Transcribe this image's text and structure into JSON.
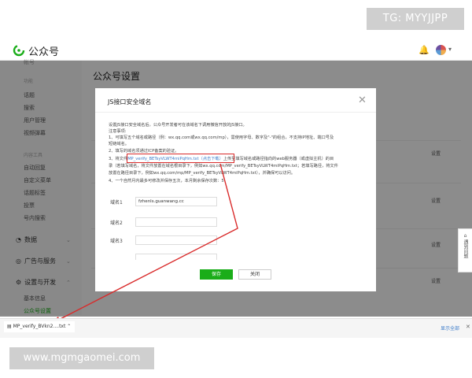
{
  "watermark_top": "TG: MYYJJPP",
  "watermark_bottom": "www.mgmgaomei.com",
  "header": {
    "app_title": "公众号",
    "bell_icon": "bell-icon",
    "avatar_icon": "avatar-icon"
  },
  "sidebar": {
    "top_partial": "帐号",
    "section_function": "功能",
    "items_function": [
      "话题",
      "搜索",
      "用户管理",
      "视频弹幕"
    ],
    "section_ext": "内容工具",
    "items_ext": [
      "自动回复",
      "自定义菜单",
      "话题标签",
      "投票",
      "号内搜索"
    ],
    "group_data": "数据",
    "group_ads": "广告与服务",
    "group_settings": "设置与开发",
    "items_settings": [
      "基本信息",
      "公众号设置"
    ]
  },
  "main": {
    "page_title": "公众号设置",
    "row_action": "设置"
  },
  "dialog": {
    "title": "JS接口安全域名",
    "lines": [
      "设置JS接口安全域名后，公众号开发者可在该域名下调用微信开放的JS接口。",
      "注意事项:",
      "1、可填写五个域名或路径（例：wx.qq.com或wx.qq.com/mp），需使用字母、数字及\"-\"的组合，不支持IP地址、端口号及",
      "短链域名。",
      "2、填写的域名须通过ICP备案的验证。"
    ],
    "line3_prefix": "3、将文件",
    "line3_link": "MP_verify_BETsyVLWT4miPqHm.txt（点击下载）",
    "line3_suffix": "上传至填写域名或路径指向的web服务器（或虚拟主机）的目",
    "line3_more": [
      "录（若填写域名，将文件放置在域名根目录下，例如wx.qq.com/MP_verify_BETsyVLWT4miPqHm.txt；若填写路径，将文件",
      "放置在路径目录下，例如wx.qq.com/mp/MP_verify_BETsyVLWT4miPqHm.txt），并确保可以访问。"
    ],
    "line4": "4、一个自然月内最多可修改并保存五次，本月剩余保存次数：5",
    "domain1_label": "域名1",
    "domain1_value": "fzhenls.guanwang.cc",
    "domain2_label": "域名2",
    "domain3_label": "域名3",
    "save_label": "保存",
    "close_label": "关闭"
  },
  "feedback": "遇到问题",
  "download_bar": {
    "file_name": "MP_verify_BVkn2....txt",
    "show_all": "显示全部"
  },
  "colors": {
    "accent": "#1aad19",
    "link": "#3d7cc9",
    "annotation": "#d92b2b"
  }
}
